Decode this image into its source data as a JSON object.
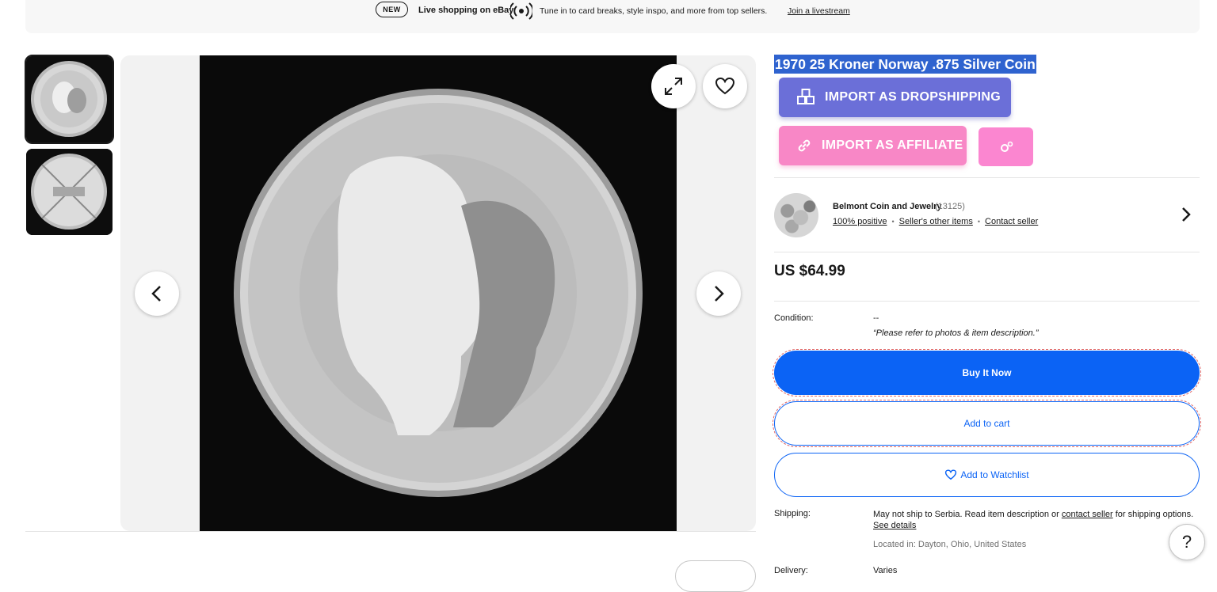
{
  "banner": {
    "badge": "NEW",
    "title": "Live shopping on eBay",
    "description": "Tune in to card breaks, style inspo, and more from top sellers.",
    "link": "Join a livestream"
  },
  "gallery": {
    "thumbnails": [
      {
        "alt": "coin obverse"
      },
      {
        "alt": "coin reverse"
      }
    ],
    "main_image_alt": "1970 25 Kroner Norway coin obverse"
  },
  "listing": {
    "title": "1970 25 Kroner Norway .875 Silver Coin",
    "price": "US $64.99",
    "condition_label": "Condition:",
    "condition_value": "--",
    "condition_note": "“Please refer to photos & item description.”"
  },
  "extension": {
    "dropshipping_label": "IMPORT AS DROPSHIPPING",
    "affiliate_label": "IMPORT AS AFFILIATE",
    "dropshipping_color": "#6b6fd8",
    "affiliate_color": "#f887c6"
  },
  "seller": {
    "name": "Belmont Coin and Jewelry",
    "feedback_count": "(13125)",
    "positive": "100% positive",
    "other_items": "Seller's other items",
    "contact": "Contact seller"
  },
  "actions": {
    "buy_now": "Buy It Now",
    "add_to_cart": "Add to cart",
    "add_to_watchlist": "Add to Watchlist",
    "primary_color": "#0b63f5"
  },
  "shipping": {
    "label": "Shipping:",
    "text_before": "May not ship to Serbia. Read item description or ",
    "contact_link": "contact seller",
    "text_after": " for shipping options.",
    "see_details": "See details",
    "location": "Located in: Dayton, Ohio, United States"
  },
  "delivery": {
    "label": "Delivery:",
    "value": "Varies"
  },
  "help": {
    "icon_label": "?"
  }
}
